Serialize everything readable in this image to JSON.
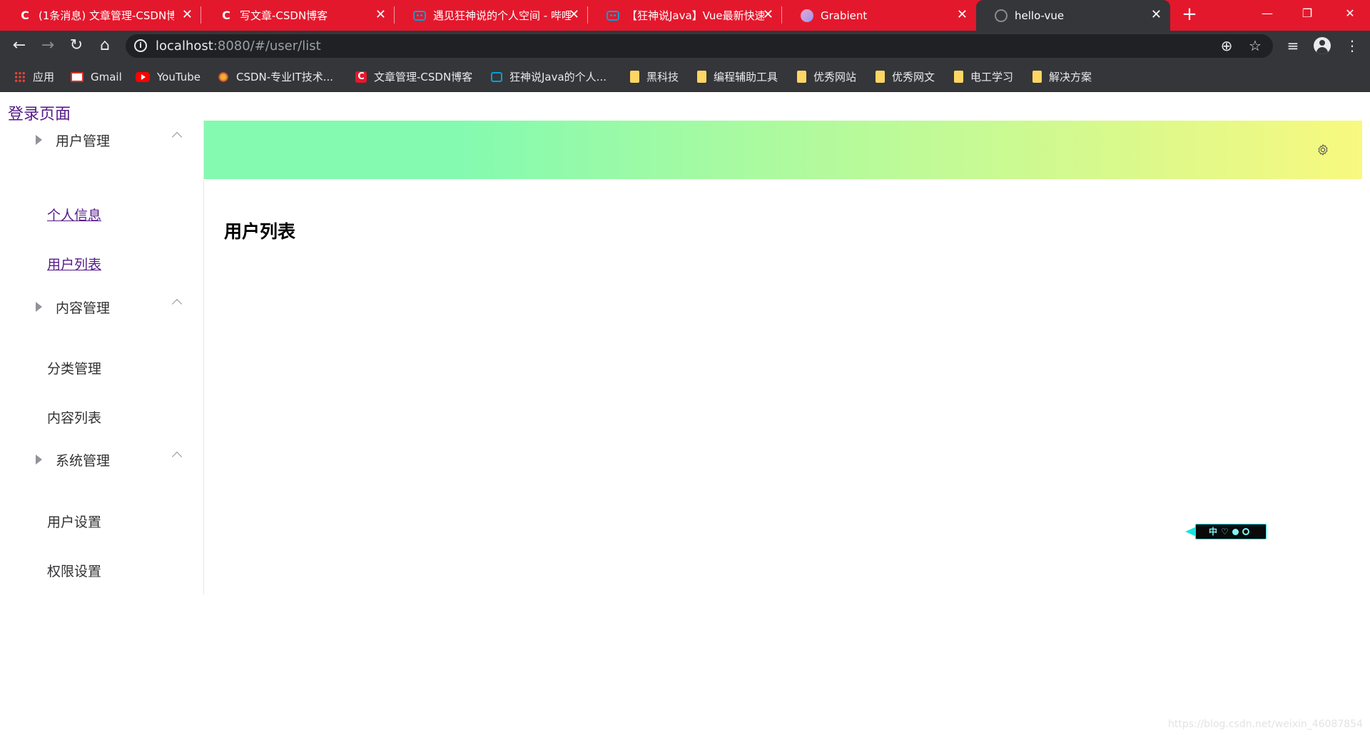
{
  "browser": {
    "tabs": [
      {
        "title": "(1条消息) 文章管理-CSDN博",
        "favicon": "csdn-icon"
      },
      {
        "title": "写文章-CSDN博客",
        "favicon": "csdn-icon"
      },
      {
        "title": "遇见狂神说的个人空间 - 哔哩",
        "favicon": "bilibili-icon"
      },
      {
        "title": "【狂神说Java】Vue最新快速",
        "favicon": "bilibili-icon"
      },
      {
        "title": "Grabient",
        "favicon": "grabient-icon"
      },
      {
        "title": "hello-vue",
        "favicon": "globe-icon",
        "active": true
      }
    ],
    "url_host": "localhost",
    "url_rest": ":8080/#/user/list",
    "bookmarks": [
      {
        "label": "应用",
        "icon": "apps-grid-icon"
      },
      {
        "label": "Gmail",
        "icon": "gmail-icon"
      },
      {
        "label": "YouTube",
        "icon": "youtube-icon"
      },
      {
        "label": "CSDN-专业IT技术...",
        "icon": "csdn-pro-icon"
      },
      {
        "label": "文章管理-CSDN博客",
        "icon": "csdn-icon"
      },
      {
        "label": "狂神说Java的个人...",
        "icon": "bilibili-icon"
      },
      {
        "label": "黑科技",
        "icon": "folder-icon"
      },
      {
        "label": "编程辅助工具",
        "icon": "folder-icon"
      },
      {
        "label": "优秀网站",
        "icon": "folder-icon"
      },
      {
        "label": "优秀网文",
        "icon": "folder-icon"
      },
      {
        "label": "电工学习",
        "icon": "folder-icon"
      },
      {
        "label": "解决方案",
        "icon": "folder-icon"
      }
    ]
  },
  "page": {
    "login_link": "登录页面",
    "menu": {
      "group1": {
        "title": "用户管理",
        "items": [
          "个人信息",
          "用户列表"
        ]
      },
      "group2": {
        "title": "内容管理",
        "items": [
          "分类管理",
          "内容列表"
        ]
      },
      "group3": {
        "title": "系统管理",
        "items": [
          "用户设置",
          "权限设置"
        ]
      }
    },
    "content_title": "用户列表",
    "widget_text": "中",
    "watermark": "https://blog.csdn.net/weixin_46087854"
  },
  "colors": {
    "tabstrip": "#e4182d",
    "toolbar": "#35363a",
    "header_gradient_start": "#84fab0",
    "header_gradient_end": "#f8f97f",
    "visited_link": "#551a8b"
  }
}
